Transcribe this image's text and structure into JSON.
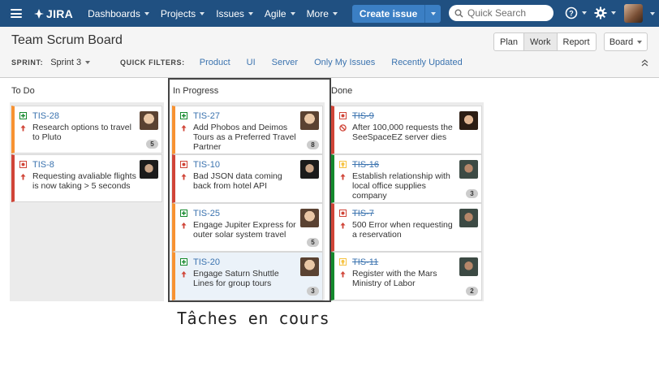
{
  "nav": {
    "logo_text": "JIRA",
    "items": [
      {
        "label": "Dashboards"
      },
      {
        "label": "Projects"
      },
      {
        "label": "Issues"
      },
      {
        "label": "Agile"
      },
      {
        "label": "More"
      }
    ],
    "create_label": "Create issue",
    "search_placeholder": "Quick Search",
    "colors": {
      "bar": "#205081",
      "create": "#3b7fc4"
    }
  },
  "header": {
    "title": "Team Scrum Board",
    "sprint_label": "SPRINT:",
    "sprint_value": "Sprint 3",
    "quick_filters_label": "QUICK FILTERS:",
    "quick_filters": [
      "Product",
      "UI",
      "Server",
      "Only My Issues",
      "Recently Updated"
    ],
    "modes": [
      "Plan",
      "Work",
      "Report"
    ],
    "active_mode": "Work",
    "board_button": "Board"
  },
  "columns": [
    {
      "title": "To Do",
      "cards": [
        {
          "key": "TIS-28",
          "summary": "Research options to travel to Pluto",
          "type": "new-feature",
          "priority": "major",
          "count": "5",
          "done": false,
          "border": "orange",
          "avatar_icon": "avatar-man-icon"
        },
        {
          "key": "TIS-8",
          "summary": "Requesting avaliable flights is now taking > 5 seconds",
          "type": "bug",
          "priority": "major",
          "count": "",
          "done": false,
          "border": "red",
          "avatar_icon": "avatar-man-dark-icon"
        }
      ]
    },
    {
      "title": "In Progress",
      "cards": [
        {
          "key": "TIS-27",
          "summary": "Add Phobos and Deimos Tours as a Preferred Travel Partner",
          "type": "new-feature",
          "priority": "major",
          "count": "8",
          "done": false,
          "border": "orange",
          "avatar_icon": "avatar-man-icon"
        },
        {
          "key": "TIS-10",
          "summary": "Bad JSON data coming back from hotel API",
          "type": "bug",
          "priority": "major",
          "count": "",
          "done": false,
          "border": "red",
          "avatar_icon": "avatar-man-dark-icon"
        },
        {
          "key": "TIS-25",
          "summary": "Engage Jupiter Express for outer solar system travel",
          "type": "new-feature",
          "priority": "major",
          "count": "5",
          "done": false,
          "border": "orange",
          "avatar_icon": "avatar-man-icon"
        },
        {
          "key": "TIS-20",
          "summary": "Engage Saturn Shuttle Lines for group tours",
          "type": "new-feature",
          "priority": "major",
          "count": "3",
          "done": false,
          "border": "orange",
          "avatar_icon": "avatar-man-icon",
          "selected": true
        }
      ]
    },
    {
      "title": "Done",
      "cards": [
        {
          "key": "TIS-9",
          "summary": "After 100,000 requests the SeeSpaceEZ server dies",
          "type": "bug",
          "priority": "blocker",
          "count": "",
          "done": true,
          "border": "red",
          "avatar_icon": "avatar-woman-icon"
        },
        {
          "key": "TIS-16",
          "summary": "Establish relationship with local office supplies company",
          "type": "improvement",
          "priority": "major",
          "count": "3",
          "done": true,
          "border": "green",
          "avatar_icon": "avatar-man-glasses-icon"
        },
        {
          "key": "TIS-7",
          "summary": "500 Error when requesting a reservation",
          "type": "bug",
          "priority": "major",
          "count": "",
          "done": true,
          "border": "red",
          "avatar_icon": "avatar-man-glasses-icon"
        },
        {
          "key": "TIS-11",
          "summary": "Register with the Mars Ministry of Labor",
          "type": "improvement",
          "priority": "major",
          "count": "2",
          "done": true,
          "border": "green",
          "avatar_icon": "avatar-man-glasses-icon"
        }
      ]
    }
  ],
  "caption": "Tâches en cours"
}
